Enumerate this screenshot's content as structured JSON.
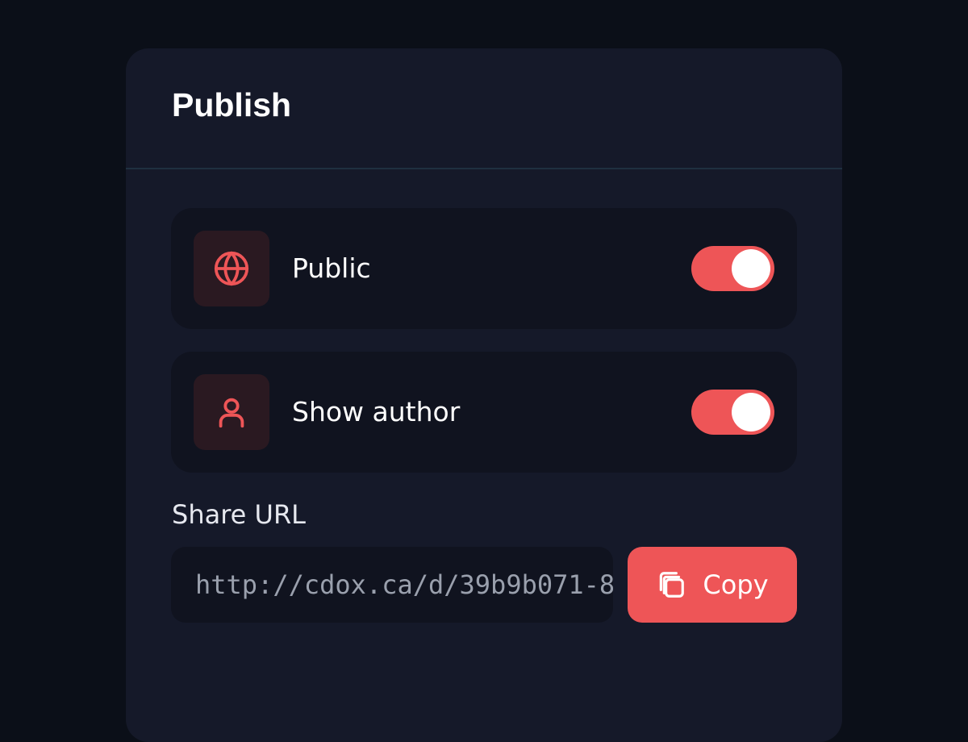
{
  "panel": {
    "title": "Publish"
  },
  "settings": [
    {
      "label": "Public",
      "icon": "globe-icon",
      "enabled": true
    },
    {
      "label": "Show author",
      "icon": "user-icon",
      "enabled": true
    }
  ],
  "share": {
    "label": "Share URL",
    "url": "http://cdox.ca/d/39b9b071-8",
    "copy_label": "Copy",
    "copy_icon": "copy-icon"
  },
  "colors": {
    "accent": "#ee5557",
    "background": "#0b0f18",
    "panel": "#151929",
    "row": "#10131f",
    "icon_tile": "#2a1921"
  }
}
